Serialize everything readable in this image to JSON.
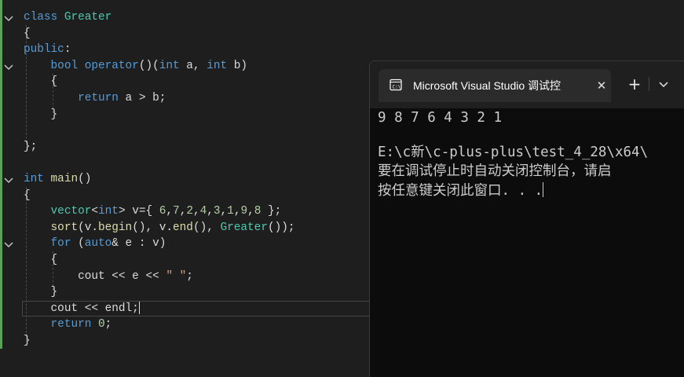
{
  "editor": {
    "lines": [
      {
        "id": "l1",
        "tokens": [
          {
            "t": "class ",
            "c": "kw"
          },
          {
            "t": "Greater",
            "c": "ty"
          }
        ]
      },
      {
        "id": "l2",
        "tokens": [
          {
            "t": "{",
            "c": "pl"
          }
        ]
      },
      {
        "id": "l3",
        "tokens": [
          {
            "t": "public",
            "c": "kw"
          },
          {
            "t": ":",
            "c": "pl"
          }
        ]
      },
      {
        "id": "l4",
        "tokens": [
          {
            "t": "    ",
            "c": "pl"
          },
          {
            "t": "bool ",
            "c": "kw"
          },
          {
            "t": "operator",
            "c": "kw"
          },
          {
            "t": "()(",
            "c": "pl"
          },
          {
            "t": "int ",
            "c": "kw"
          },
          {
            "t": "a, ",
            "c": "pl"
          },
          {
            "t": "int ",
            "c": "kw"
          },
          {
            "t": "b)",
            "c": "pl"
          }
        ]
      },
      {
        "id": "l5",
        "tokens": [
          {
            "t": "    {",
            "c": "pl"
          }
        ]
      },
      {
        "id": "l6",
        "tokens": [
          {
            "t": "        ",
            "c": "pl"
          },
          {
            "t": "return ",
            "c": "kw"
          },
          {
            "t": "a > b;",
            "c": "pl"
          }
        ]
      },
      {
        "id": "l7",
        "tokens": [
          {
            "t": "    }",
            "c": "pl"
          }
        ]
      },
      {
        "id": "l8",
        "tokens": []
      },
      {
        "id": "l9",
        "tokens": [
          {
            "t": "};",
            "c": "pl"
          }
        ]
      },
      {
        "id": "l10",
        "tokens": []
      },
      {
        "id": "l11",
        "tokens": [
          {
            "t": "int ",
            "c": "kw"
          },
          {
            "t": "main",
            "c": "fn"
          },
          {
            "t": "()",
            "c": "pl"
          }
        ]
      },
      {
        "id": "l12",
        "tokens": [
          {
            "t": "{",
            "c": "pl"
          }
        ]
      },
      {
        "id": "l13",
        "tokens": [
          {
            "t": "    ",
            "c": "pl"
          },
          {
            "t": "vector",
            "c": "ty"
          },
          {
            "t": "<",
            "c": "pl"
          },
          {
            "t": "int",
            "c": "kw"
          },
          {
            "t": "> v={ ",
            "c": "pl"
          },
          {
            "t": "6",
            "c": "nm"
          },
          {
            "t": ",",
            "c": "pl"
          },
          {
            "t": "7",
            "c": "nm"
          },
          {
            "t": ",",
            "c": "pl"
          },
          {
            "t": "2",
            "c": "nm"
          },
          {
            "t": ",",
            "c": "pl"
          },
          {
            "t": "4",
            "c": "nm"
          },
          {
            "t": ",",
            "c": "pl"
          },
          {
            "t": "3",
            "c": "nm"
          },
          {
            "t": ",",
            "c": "pl"
          },
          {
            "t": "1",
            "c": "nm"
          },
          {
            "t": ",",
            "c": "pl"
          },
          {
            "t": "9",
            "c": "nm"
          },
          {
            "t": ",",
            "c": "pl"
          },
          {
            "t": "8",
            "c": "nm"
          },
          {
            "t": " };",
            "c": "pl"
          }
        ]
      },
      {
        "id": "l14",
        "tokens": [
          {
            "t": "    ",
            "c": "pl"
          },
          {
            "t": "sort",
            "c": "fn"
          },
          {
            "t": "(v.",
            "c": "pl"
          },
          {
            "t": "begin",
            "c": "fn"
          },
          {
            "t": "(), v.",
            "c": "pl"
          },
          {
            "t": "end",
            "c": "fn"
          },
          {
            "t": "(), ",
            "c": "pl"
          },
          {
            "t": "Greater",
            "c": "ty"
          },
          {
            "t": "());",
            "c": "pl"
          }
        ]
      },
      {
        "id": "l15",
        "tokens": [
          {
            "t": "    ",
            "c": "pl"
          },
          {
            "t": "for ",
            "c": "kw"
          },
          {
            "t": "(",
            "c": "pl"
          },
          {
            "t": "auto",
            "c": "kw"
          },
          {
            "t": "& e : v)",
            "c": "pl"
          }
        ]
      },
      {
        "id": "l16",
        "tokens": [
          {
            "t": "    {",
            "c": "pl"
          }
        ]
      },
      {
        "id": "l17",
        "tokens": [
          {
            "t": "        cout << e << ",
            "c": "pl"
          },
          {
            "t": "\" \"",
            "c": "st"
          },
          {
            "t": ";",
            "c": "pl"
          }
        ]
      },
      {
        "id": "l18",
        "tokens": [
          {
            "t": "    }",
            "c": "pl"
          }
        ]
      },
      {
        "id": "l19",
        "tokens": [
          {
            "t": "    cout << endl;",
            "c": "pl"
          }
        ],
        "caret": true
      },
      {
        "id": "l20",
        "tokens": [
          {
            "t": "    ",
            "c": "pl"
          },
          {
            "t": "return ",
            "c": "kw"
          },
          {
            "t": "0",
            "c": "nm"
          },
          {
            "t": ";",
            "c": "pl"
          }
        ]
      },
      {
        "id": "l21",
        "tokens": [
          {
            "t": "}",
            "c": "pl"
          }
        ]
      }
    ]
  },
  "console": {
    "tab_title": "Microsoft Visual Studio 调试控",
    "tab_icon": "terminal-icon",
    "close_glyph": "✕",
    "new_tab_glyph": "+",
    "dropdown_icon": "chevron-down-icon",
    "output_line1": "9 8 7 6 4 3 2 1",
    "output_line2": "E:\\c新\\c-plus-plus\\test_4_28\\x64\\",
    "output_line3": "要在调试停止时自动关闭控制台，请启",
    "output_line4": "按任意键关闭此窗口. . ."
  },
  "colors": {
    "editor_bg": "#1e1e1e",
    "keyword": "#569cd6",
    "type": "#4ec9b0",
    "function": "#dcdcaa",
    "number": "#b5cea8",
    "string": "#d69d85",
    "change_bar": "#5aa05a",
    "console_bg": "#0c0c0c"
  }
}
